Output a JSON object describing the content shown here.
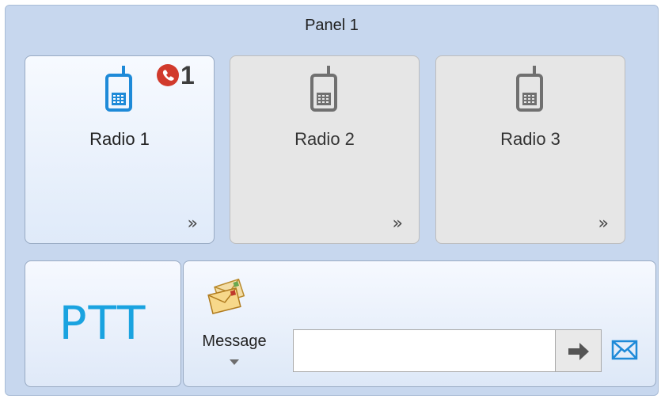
{
  "panel": {
    "title": "Panel 1"
  },
  "radios": [
    {
      "label": "Radio 1",
      "active": true,
      "call_count": "1",
      "expand_glyph": "»"
    },
    {
      "label": "Radio 2",
      "active": false,
      "expand_glyph": "»"
    },
    {
      "label": "Radio 3",
      "active": false,
      "expand_glyph": "»"
    }
  ],
  "ptt": {
    "label": "PTT"
  },
  "message": {
    "label": "Message",
    "input_value": "",
    "input_placeholder": "",
    "send_icon": "right-arrow-icon",
    "mail_icon": "mail-icon"
  },
  "colors": {
    "active_phone": "#1e8ad8",
    "inactive_phone": "#707070",
    "call_badge": "#d13a2c",
    "ptt_text": "#1aa3e0",
    "panel_bg": "#c7d7ee"
  }
}
